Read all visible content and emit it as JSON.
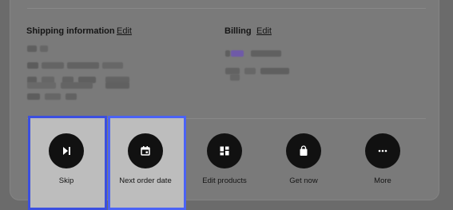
{
  "shipping": {
    "title": "Shipping information",
    "edit_label": "Edit"
  },
  "billing": {
    "title": "Billing",
    "edit_label": "Edit"
  },
  "actions": [
    {
      "label": "Skip",
      "icon": "skip-next-icon"
    },
    {
      "label": "Next order date",
      "icon": "calendar-icon"
    },
    {
      "label": "Edit products",
      "icon": "grid-icon"
    },
    {
      "label": "Get now",
      "icon": "shopping-bag-icon"
    },
    {
      "label": "More",
      "icon": "more-dots-icon"
    }
  ],
  "colors": {
    "overlay_bg": "#6b6b6b",
    "card_bg": "#7a7a7a",
    "highlight_border": "#3b4fe0",
    "button_bg": "#111111",
    "billing_accent": "#6f5aa8"
  }
}
